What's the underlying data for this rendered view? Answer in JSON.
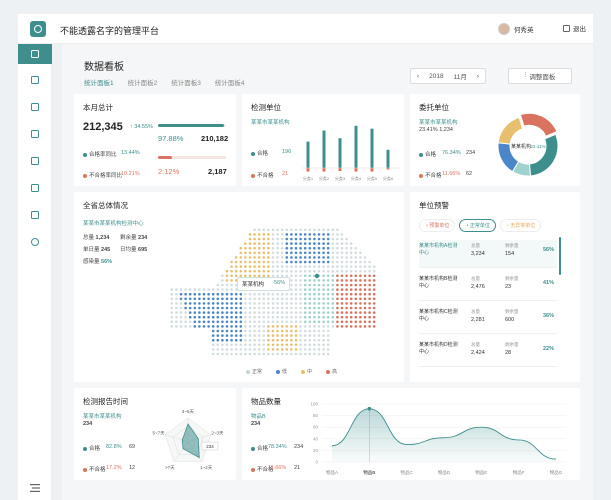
{
  "app": {
    "title": "不能透露名字的管理平台",
    "user": "何秀英",
    "logout": "退出"
  },
  "page": {
    "title": "数据看板",
    "tabs": [
      "统计面板1",
      "统计面板2",
      "统计面板3",
      "统计面板4"
    ],
    "date": "2018",
    "month": "11月",
    "filter_label": "调整面板"
  },
  "colors": {
    "teal": "#3f8e8e",
    "red": "#d9735f",
    "yellow": "#e7c06f",
    "blue": "#4a86c8"
  },
  "monthly": {
    "title": "本月总计",
    "total": "212,345",
    "growth": "↑ 34.55%",
    "pass_rate_label": "合格率同比",
    "pass_rate": "13.44%",
    "fail_rate_label": "不合格率同比",
    "fail_rate": "10.21%",
    "pass_pct": "97.88%",
    "pass_count": "210,182",
    "pass_fill": 0.97,
    "fail_pct": "2.12%",
    "fail_count": "2,187",
    "fail_fill": 0.2
  },
  "inspect": {
    "title": "检测单位",
    "unit": "某某市某某机构",
    "pass_label": "合格",
    "pass": "196",
    "fail_label": "不合格",
    "fail": "21",
    "bars": [
      {
        "label": "分类1",
        "teal": 0.55,
        "red": 0.12
      },
      {
        "label": "分类2",
        "teal": 0.78,
        "red": 0.12
      },
      {
        "label": "分类3",
        "teal": 0.62,
        "red": 0.1
      },
      {
        "label": "分类4",
        "teal": 0.88,
        "red": 0.12
      },
      {
        "label": "分类5",
        "teal": 0.82,
        "red": 0.12
      },
      {
        "label": "分类6",
        "teal": 0.38,
        "red": 0.05
      }
    ]
  },
  "delegate": {
    "title": "委托单位",
    "unit": "某某市某某机构",
    "rate": "23.41%",
    "count": "1,234",
    "pass_label": "合格",
    "pass_pct": "76.34%",
    "pass": "234",
    "fail_label": "不合格",
    "fail_pct": "11.66%",
    "fail": "62",
    "donut_center": "某某机构",
    "donut_pct": "23.41%",
    "slices": [
      {
        "value": 23.41,
        "color": "#d9735f"
      },
      {
        "value": 30,
        "color": "#3f8e8e"
      },
      {
        "value": 10,
        "color": "#9fd2cc"
      },
      {
        "value": 18,
        "color": "#4a86c8"
      },
      {
        "value": 18.59,
        "color": "#e7c06f"
      }
    ]
  },
  "province": {
    "title": "全省总体情况",
    "center": "某某市某某机构检测中心",
    "rows": [
      {
        "label": "总量",
        "value": "1,234",
        "label2": "剩余量",
        "value2": "234"
      },
      {
        "label": "单日量",
        "value": "245",
        "label2": "日均量",
        "value2": "695"
      },
      {
        "label": "感染量",
        "value": "56%",
        "label2": "",
        "value2": ""
      }
    ],
    "tooltip_name": "某某机构",
    "tooltip_pct": "56%",
    "legend": [
      "正常",
      "低",
      "中",
      "高"
    ]
  },
  "alert": {
    "title": "单位预警",
    "filters": [
      "预警单位",
      "正常单位",
      "无异常单位"
    ],
    "col1": "总量",
    "col2": "剩余量",
    "rows": [
      {
        "name": "某某市机构A检测中心",
        "total": "3,234",
        "remain": "154",
        "pct": "56%"
      },
      {
        "name": "某某市机构B检测中心",
        "total": "2,476",
        "remain": "23",
        "pct": "41%"
      },
      {
        "name": "某某市机构C检测中心",
        "total": "2,281",
        "remain": "600",
        "pct": "36%"
      },
      {
        "name": "某某市机构D检测中心",
        "total": "2,424",
        "remain": "28",
        "pct": "22%"
      }
    ]
  },
  "report": {
    "title": "检测报告时间",
    "unit": "某某市某某机构",
    "count": "234",
    "pass_label": "合格",
    "pass_pct": "82.8%",
    "pass": "69",
    "fail_label": "不合格",
    "fail_pct": "17.2%",
    "fail": "12",
    "axes": [
      "4~5天",
      "2~3天",
      "1~2天",
      ">7天",
      "5~7天"
    ],
    "value_label": "234"
  },
  "items": {
    "title": "物品数量",
    "unit": "物品B",
    "count": "234",
    "pass_label": "合格",
    "pass_pct": "78.34%",
    "pass": "234",
    "fail_label": "不合格",
    "fail_pct": "11.66%",
    "fail": "21",
    "y_ticks": [
      "100",
      "80",
      "60",
      "40",
      "20",
      "0"
    ],
    "categories": [
      "物品A",
      "物品B",
      "物品C",
      "物品D",
      "物品E",
      "物品F",
      "物品G"
    ],
    "values": [
      28,
      92,
      30,
      42,
      60,
      38,
      5
    ]
  }
}
